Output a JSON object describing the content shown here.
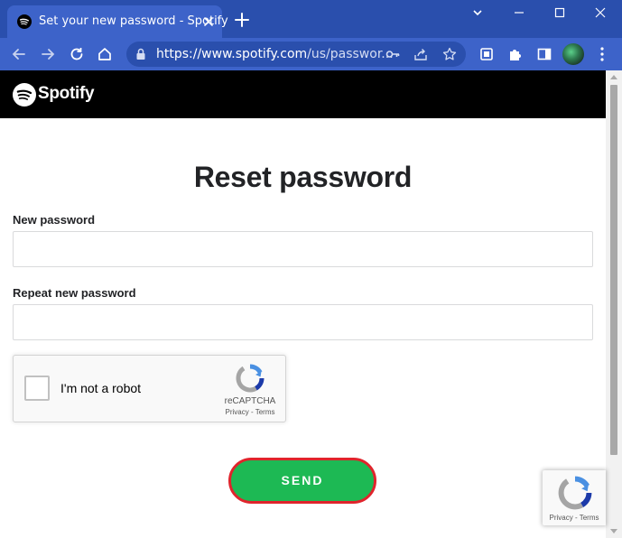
{
  "browser": {
    "tab_title": "Set your new password - Spotify",
    "url_host": "https://www.spotify.com",
    "url_path": "/us/passwor...",
    "colors": {
      "titlebar": "#2a4fad",
      "toolbar": "#3d63c9"
    }
  },
  "site": {
    "brand": "Spotify",
    "colors": {
      "header": "#000000",
      "accent": "#1db954"
    }
  },
  "form": {
    "title": "Reset password",
    "new_password_label": "New password",
    "new_password_value": "",
    "repeat_password_label": "Repeat new password",
    "repeat_password_value": "",
    "submit_label": "SEND"
  },
  "captcha": {
    "label": "I'm not a robot",
    "brand": "reCAPTCHA",
    "links": "Privacy - Terms",
    "checked": false
  },
  "recaptcha_badge": {
    "links": "Privacy - Terms"
  }
}
